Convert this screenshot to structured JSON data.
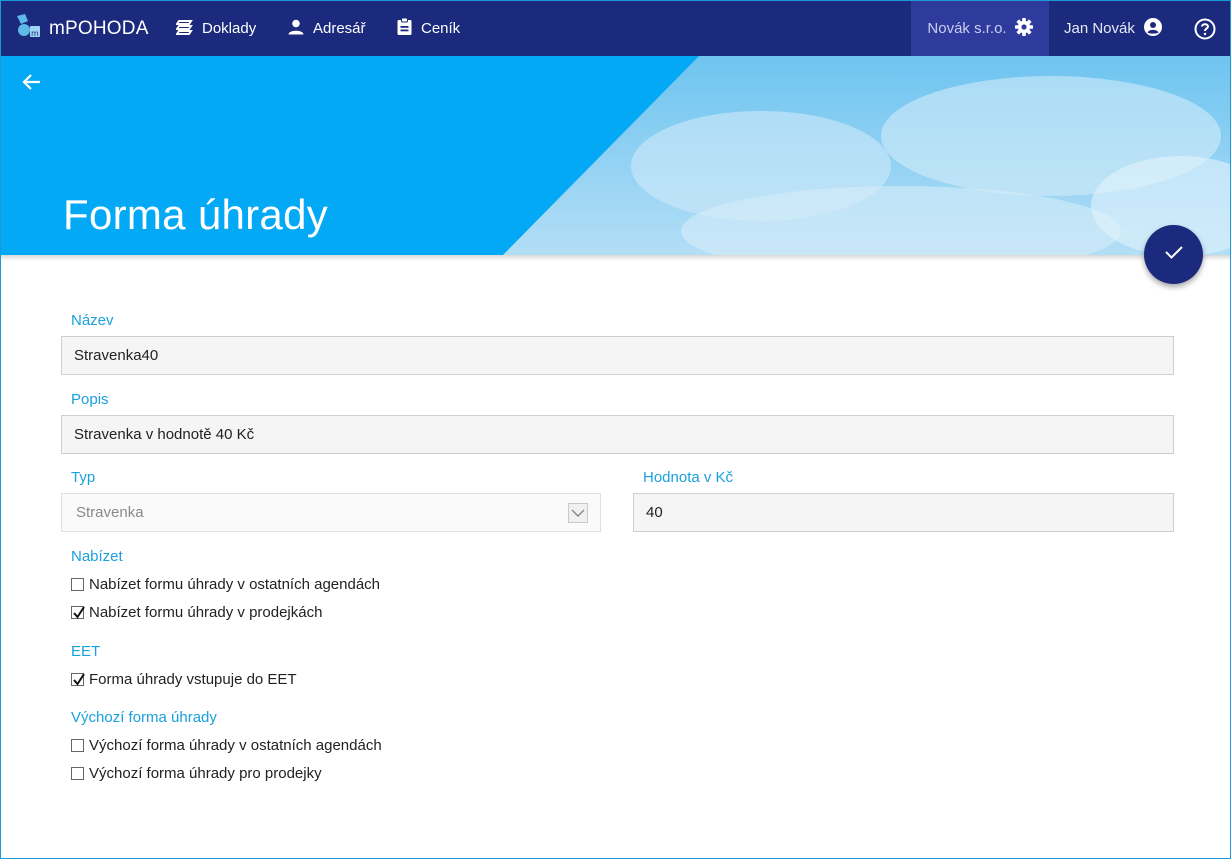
{
  "app": {
    "brand": "mPOHODA"
  },
  "nav": {
    "items": [
      {
        "label": "Doklady",
        "icon": "documents-stack-icon"
      },
      {
        "label": "Adresář",
        "icon": "person-icon"
      },
      {
        "label": "Ceník",
        "icon": "clipboard-icon"
      }
    ],
    "company": "Novák s.r.o.",
    "user": "Jan Novák"
  },
  "page": {
    "title": "Forma úhrady"
  },
  "form": {
    "name": {
      "label": "Název",
      "value": "Stravenka40"
    },
    "description": {
      "label": "Popis",
      "value": "Stravenka v hodnotě 40 Kč"
    },
    "type": {
      "label": "Typ",
      "value": "Stravenka"
    },
    "amount": {
      "label": "Hodnota v Kč",
      "value": "40"
    },
    "offer": {
      "label": "Nabízet",
      "options": [
        {
          "label": "Nabízet formu úhrady v ostatních agendách",
          "checked": false
        },
        {
          "label": "Nabízet formu úhrady v prodejkách",
          "checked": true
        }
      ]
    },
    "eet": {
      "label": "EET",
      "options": [
        {
          "label": "Forma úhrady vstupuje do EET",
          "checked": true
        }
      ]
    },
    "default": {
      "label": "Výchozí forma úhrady",
      "options": [
        {
          "label": "Výchozí forma úhrady v ostatních agendách",
          "checked": false
        },
        {
          "label": "Výchozí forma úhrady pro prodejky",
          "checked": false
        }
      ]
    }
  },
  "colors": {
    "topbar": "#1b2a7c",
    "company_bg": "#2e3b9c",
    "accent": "#1aa0dc",
    "hero_blue": "#03a9f4",
    "fab": "#1b2a7c"
  }
}
